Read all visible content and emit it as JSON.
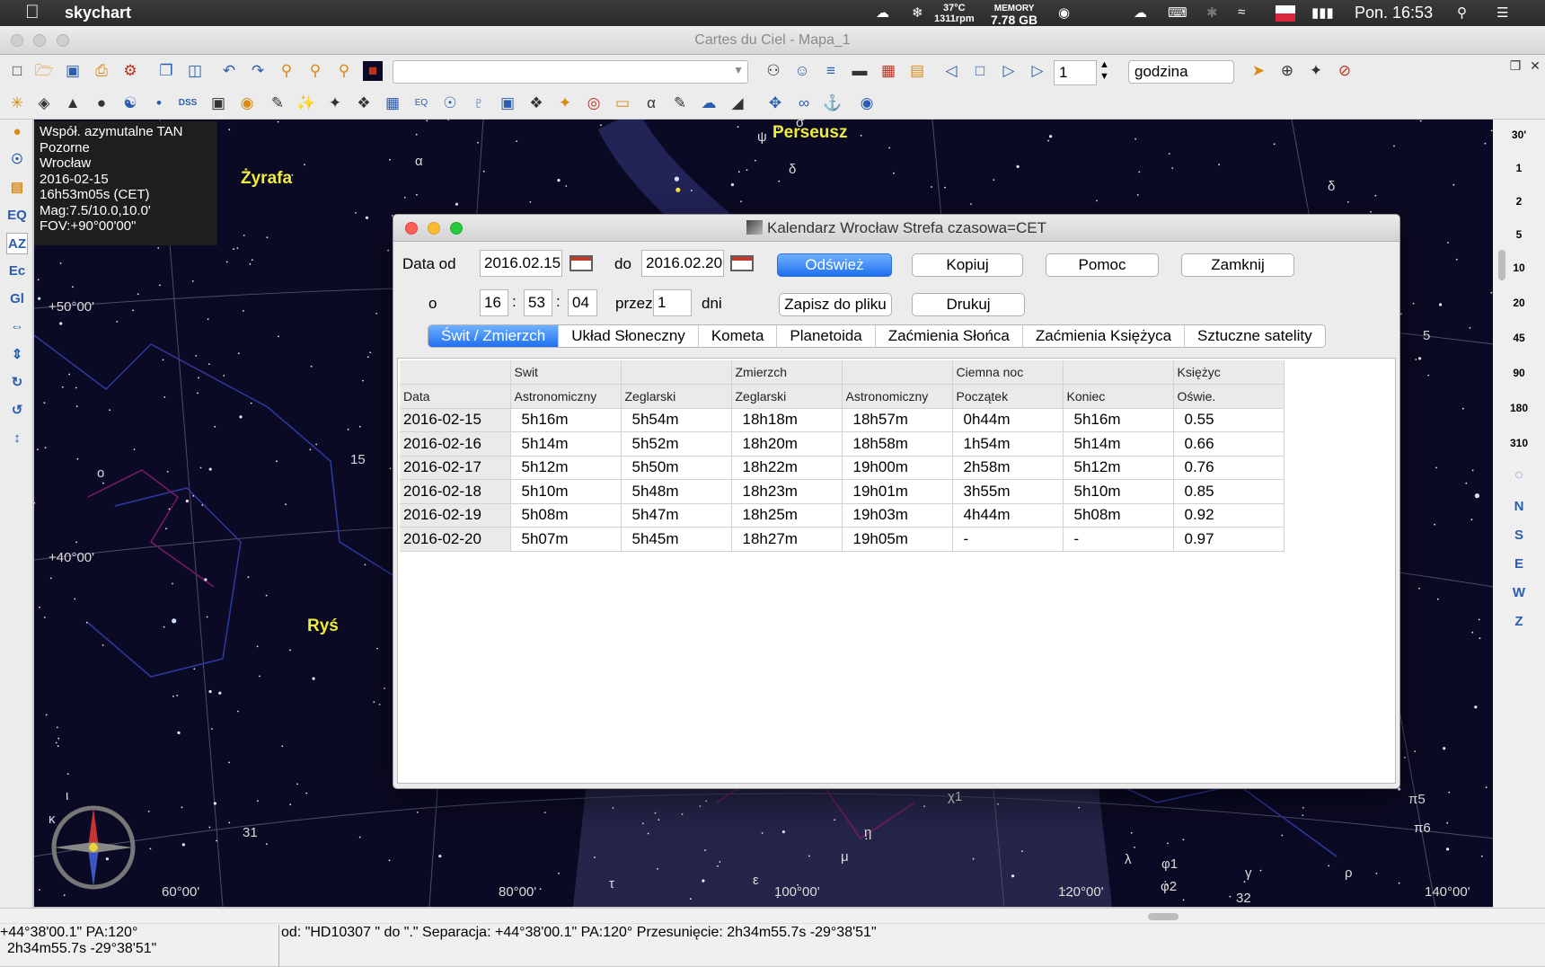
{
  "menubar": {
    "app_name": "skychart",
    "temp": "37°C",
    "rpm": "1311rpm",
    "memory_label": "MEMORY",
    "memory_value": "7.78 GB",
    "clock": "Pon. 16:53"
  },
  "window": {
    "title": "Cartes du Ciel - Mapa_1"
  },
  "toolbar": {
    "search_value": "",
    "step_value": "1",
    "unit_select": "godzina"
  },
  "leftbar": {
    "eq": "EQ",
    "az": "AZ",
    "ec": "Ec",
    "gl": "Gl"
  },
  "rightbar": {
    "fov_buttons": [
      "30'",
      "1",
      "2",
      "5",
      "10",
      "20",
      "45",
      "90",
      "180",
      "310"
    ],
    "directions": [
      "N",
      "S",
      "E",
      "W",
      "Z"
    ]
  },
  "infobox": {
    "line1": "Współ. azymutalne TAN",
    "line2": "Pozorne",
    "line3": "Wrocław",
    "line4": "2016-02-15",
    "line5": "16h53m05s (CET)",
    "line6": "Mag:7.5/10.0,10.0'",
    "line7": "FOV:+90°00'00\""
  },
  "sky": {
    "constellations": [
      "Perseusz",
      "Żyrafa",
      "Ryś"
    ],
    "altitude_labels": [
      "+50°00'",
      "+40°00'"
    ],
    "azimuth_labels": [
      "60°00'",
      "80°00'",
      "100°00'",
      "120°00'",
      "140°00'"
    ],
    "star_labels": {
      "alpha": "α",
      "psi": "ψ",
      "delta": "δ",
      "sigma": "σ",
      "delta2": "δ",
      "n15": "15",
      "omicron": "o",
      "n5": "5",
      "n31": "31",
      "iota": "ι",
      "kappa": "κ",
      "chi1": "χ1",
      "eta": "η",
      "mu": "μ",
      "epsilon": "ε",
      "tau": "τ",
      "lambda": "λ",
      "phi1": "φ1",
      "phi2": "φ2",
      "gamma": "γ",
      "n32": "32",
      "rho": "ρ",
      "pi5": "π5",
      "pi6": "π6"
    }
  },
  "status": {
    "line1": "+44°38'00.1\" PA:120°",
    "line2": "2h34m55.7s -29°38'51\"",
    "main": "od:  \"HD10307 \" do \".\" Separacja: +44°38'00.1\" PA:120° Przesunięcie:  2h34m55.7s -29°38'51\""
  },
  "dialog": {
    "title": "Kalendarz Wrocław Strefa czasowa=CET",
    "date_from_label": "Data od",
    "date_from": "2016.02.15",
    "to_label": "do",
    "date_to": "2016.02.20",
    "at_label": "o",
    "hour": "16",
    "minute": "53",
    "second": "04",
    "sep": ":",
    "for_label": "przez",
    "for_value": "1",
    "days_label": "dni",
    "buttons": {
      "refresh": "Odśwież",
      "copy": "Kopiuj",
      "help": "Pomoc",
      "close": "Zamknij",
      "save": "Zapisz do pliku",
      "print": "Drukuj"
    },
    "tabs": [
      "Świt / Zmierzch",
      "Układ Słoneczny",
      "Kometa",
      "Planetoida",
      "Zaćmienia Słońca",
      "Zaćmienia Księżyca",
      "Sztuczne satelity"
    ],
    "table": {
      "group_headers": [
        "",
        "Swit",
        "",
        "Zmierzch",
        "",
        "Ciemna noc",
        "",
        "Księżyc"
      ],
      "headers": [
        "Data",
        "Astronomiczny",
        "Zeglarski",
        "Zeglarski",
        "Astronomiczny",
        "Początek",
        "Koniec",
        "Oświe."
      ],
      "rows": [
        [
          "2016-02-15",
          "5h16m",
          "5h54m",
          "18h18m",
          "18h57m",
          "0h44m",
          "5h16m",
          "0.55"
        ],
        [
          "2016-02-16",
          "5h14m",
          "5h52m",
          "18h20m",
          "18h58m",
          "1h54m",
          "5h14m",
          "0.66"
        ],
        [
          "2016-02-17",
          "5h12m",
          "5h50m",
          "18h22m",
          "19h00m",
          "2h58m",
          "5h12m",
          "0.76"
        ],
        [
          "2016-02-18",
          "5h10m",
          "5h48m",
          "18h23m",
          "19h01m",
          "3h55m",
          "5h10m",
          "0.85"
        ],
        [
          "2016-02-19",
          "5h08m",
          "5h47m",
          "18h25m",
          "19h03m",
          "4h44m",
          "5h08m",
          "0.92"
        ],
        [
          "2016-02-20",
          "5h07m",
          "5h45m",
          "18h27m",
          "19h05m",
          "-",
          "-",
          "0.97"
        ]
      ]
    }
  },
  "colors": {
    "accent": "#1e6ff0",
    "constellation": "#f0ec3c",
    "sky": "#0b0a24"
  }
}
